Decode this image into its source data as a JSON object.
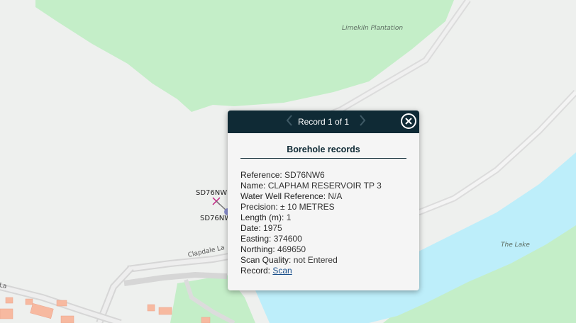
{
  "map": {
    "labels": {
      "plantation": "Limekiln Plantation",
      "lake": "The Lake",
      "road": "Clapdale La",
      "road_fragment": "La"
    },
    "borehole_labels": [
      "SD76NW",
      "SD76NW"
    ],
    "colors": {
      "background": "#eef0ee",
      "woodland": "#c4eec8",
      "water": "#bdeefa",
      "road": "#d9d9d9",
      "building": "#f7b9a0"
    }
  },
  "popup": {
    "record_count": "Record 1 of 1",
    "prev_icon": "chevron-left-icon",
    "next_icon": "chevron-right-icon",
    "close_icon": "close-icon",
    "title": "Borehole records",
    "fields": [
      {
        "label": "Reference:",
        "value": "SD76NW6"
      },
      {
        "label": "Name:",
        "value": "CLAPHAM RESERVOIR TP 3"
      },
      {
        "label": "Water Well Reference:",
        "value": "N/A"
      },
      {
        "label": "Precision:",
        "value": "± 10 METRES"
      },
      {
        "label": "Length (m):",
        "value": "1"
      },
      {
        "label": "Date:",
        "value": "1975"
      },
      {
        "label": "Easting:",
        "value": "374600"
      },
      {
        "label": "Northing:",
        "value": "469650"
      },
      {
        "label": "Scan Quality:",
        "value": "not Entered"
      }
    ],
    "record_label": "Record:",
    "record_link": "Scan",
    "colors": {
      "header": "#0f2a35",
      "link": "#1a4f8b"
    }
  }
}
